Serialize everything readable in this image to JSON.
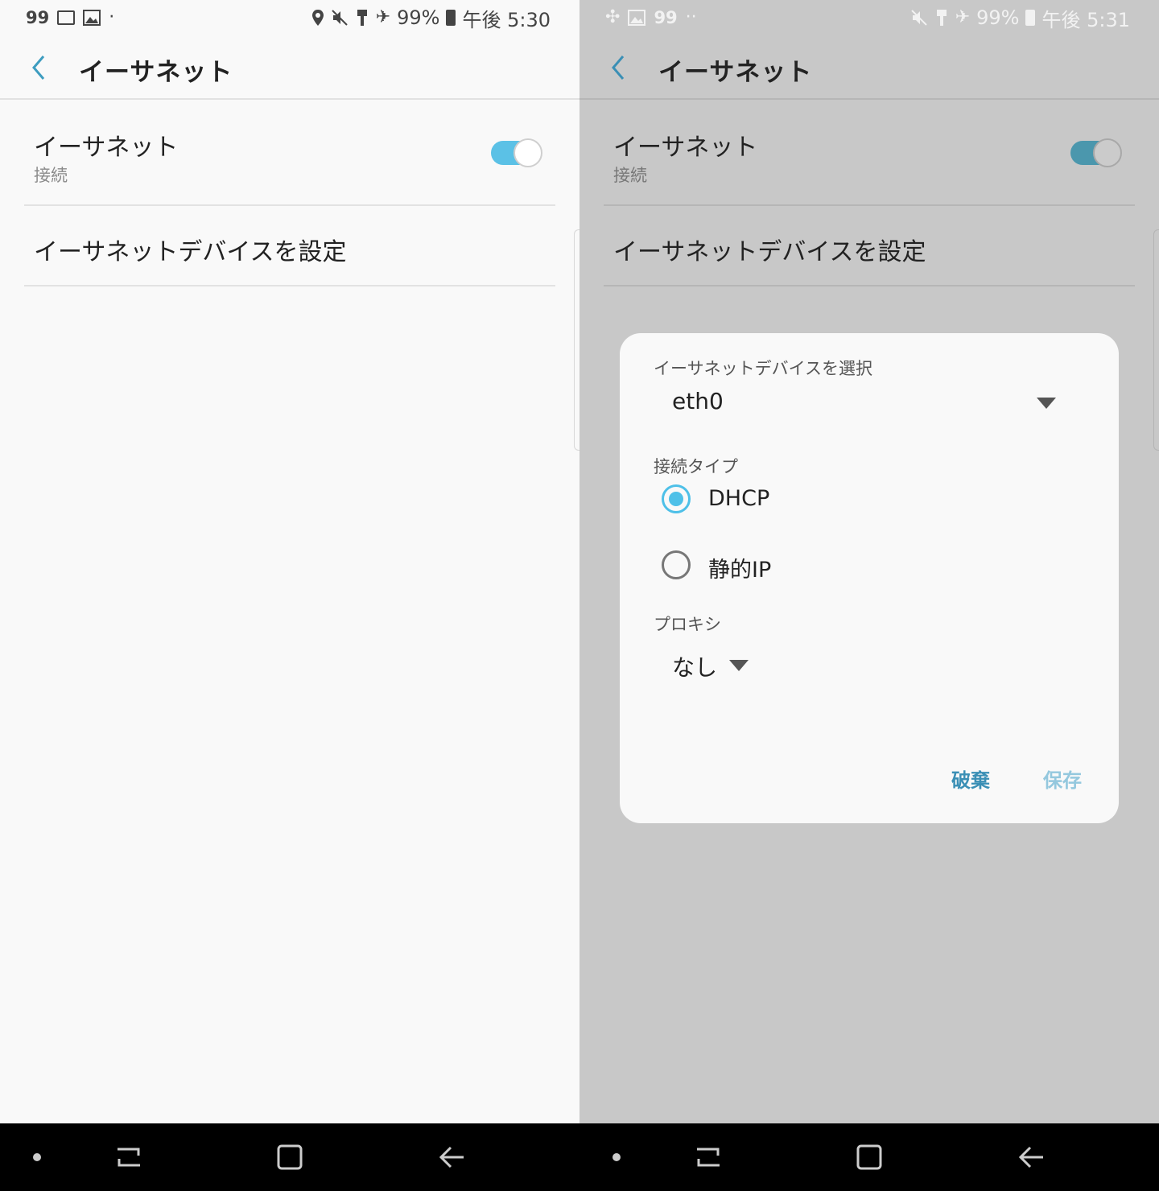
{
  "left": {
    "status": {
      "left_num": "99",
      "right_text": "99%",
      "time": "午後 5:30"
    },
    "appbar": {
      "title": "イーサネット"
    },
    "ethernet_row": {
      "title": "イーサネット",
      "subtitle": "接続",
      "toggle_on": true
    },
    "setup_row": {
      "title": "イーサネットデバイスを設定"
    }
  },
  "right": {
    "status": {
      "left_num": "99",
      "right_text": "99%",
      "time": "午後 5:31"
    },
    "appbar": {
      "title": "イーサネット"
    },
    "ethernet_row": {
      "title": "イーサネット",
      "subtitle": "接続",
      "toggle_on": true
    },
    "setup_row": {
      "title": "イーサネットデバイスを設定"
    },
    "dialog": {
      "device_label": "イーサネットデバイスを選択",
      "device_value": "eth0",
      "conn_type_label": "接続タイプ",
      "conn_options": [
        {
          "label": "DHCP",
          "selected": true
        },
        {
          "label": "静的IP",
          "selected": false
        }
      ],
      "proxy_label": "プロキシ",
      "proxy_value": "なし",
      "discard_label": "破棄",
      "save_label": "保存",
      "discard_color": "#3a8fb5",
      "save_color": "#94c8de"
    }
  },
  "colors": {
    "accent": "#4ec0e8",
    "toggle_track": "#5bc1e6",
    "back_arrow": "#3e9dc0"
  }
}
